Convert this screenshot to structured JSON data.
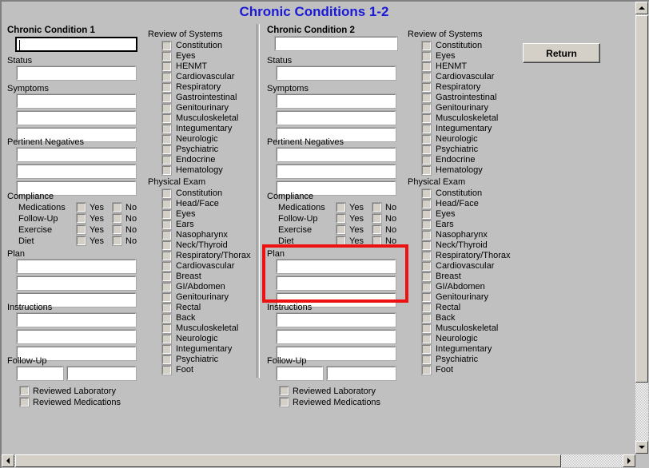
{
  "window": {
    "title": "Chronic Conditions 1-2",
    "title_color": "#1a1ad6",
    "background_color": "#c0c0c0"
  },
  "toolbar": {
    "return_label": "Return"
  },
  "annotation": {
    "highlight_color": "#ee1111",
    "target": "condition2-plan-group"
  },
  "labels": {
    "status": "Status",
    "symptoms": "Symptoms",
    "pertinent_negatives": "Pertinent Negatives",
    "compliance": "Compliance",
    "plan": "Plan",
    "instructions": "Instructions",
    "follow_up": "Follow-Up",
    "review_of_systems": "Review of Systems",
    "physical_exam": "Physical Exam",
    "yes": "Yes",
    "no": "No",
    "reviewed_laboratory": "Reviewed Laboratory",
    "reviewed_medications": "Reviewed Medications"
  },
  "compliance_rows": [
    "Medications",
    "Follow-Up",
    "Exercise",
    "Diet"
  ],
  "review_of_systems": [
    "Constitution",
    "Eyes",
    "HENMT",
    "Cardiovascular",
    "Respiratory",
    "Gastrointestinal",
    "Genitourinary",
    "Musculoskeletal",
    "Integumentary",
    "Neurologic",
    "Psychiatric",
    "Endocrine",
    "Hematology"
  ],
  "physical_exam": [
    "Constitution",
    "Head/Face",
    "Eyes",
    "Ears",
    "Nasopharynx",
    "Neck/Thyroid",
    "Respiratory/Thorax",
    "Cardiovascular",
    "Breast",
    "GI/Abdomen",
    "Genitourinary",
    "Rectal",
    "Back",
    "Musculoskeletal",
    "Neurologic",
    "Integumentary",
    "Psychiatric",
    "Foot"
  ],
  "condition1": {
    "heading": "Chronic Condition 1",
    "name_value": "",
    "status_value": "",
    "symptoms_values": [
      "",
      "",
      ""
    ],
    "pertinent_negatives_values": [
      "",
      "",
      ""
    ],
    "plan_values": [
      "",
      "",
      ""
    ],
    "instructions_values": [
      "",
      "",
      ""
    ],
    "follow_up_values": [
      "",
      ""
    ]
  },
  "condition2": {
    "heading": "Chronic Condition 2",
    "name_value": "",
    "status_value": "",
    "symptoms_values": [
      "",
      "",
      ""
    ],
    "pertinent_negatives_values": [
      "",
      "",
      ""
    ],
    "plan_values": [
      "",
      "",
      ""
    ],
    "instructions_values": [
      "",
      "",
      ""
    ],
    "follow_up_values": [
      "",
      ""
    ]
  },
  "scrollbars": {
    "vertical": {
      "up": "scroll-up-arrow",
      "down": "scroll-down-arrow"
    },
    "horizontal": {
      "left": "scroll-left-arrow",
      "right": "scroll-right-arrow"
    }
  }
}
